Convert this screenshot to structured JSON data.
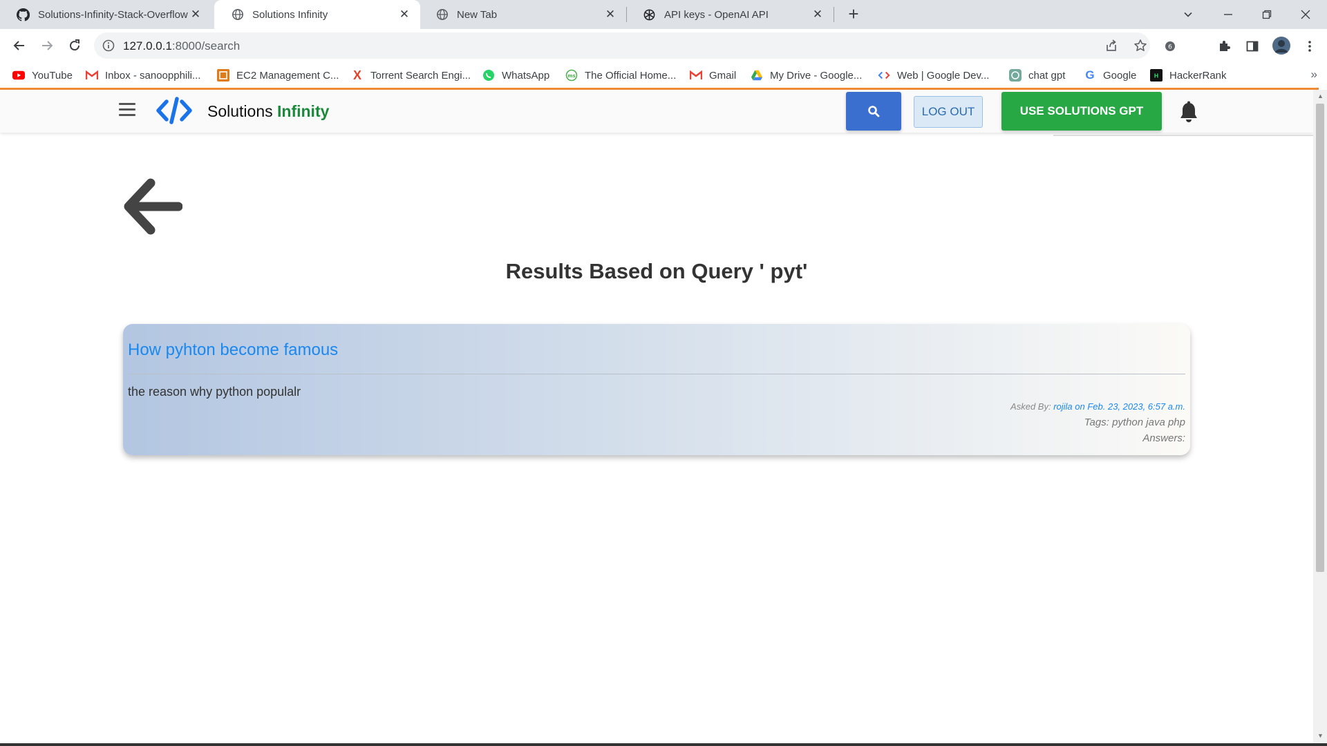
{
  "browser": {
    "tabs": [
      {
        "title": "Solutions-Infinity-Stack-Overflow",
        "icon": "github-icon",
        "active": false
      },
      {
        "title": "Solutions Infinity",
        "icon": "globe-icon",
        "active": true
      },
      {
        "title": "New Tab",
        "icon": "globe-icon",
        "active": false
      },
      {
        "title": "API keys - OpenAI API",
        "icon": "openai-icon",
        "active": false
      }
    ],
    "url_host": "127.0.0.1",
    "url_path": ":8000/search",
    "bookmarks": [
      {
        "label": "YouTube",
        "icon": "youtube-icon"
      },
      {
        "label": "Inbox - sanoopphili...",
        "icon": "gmail-icon"
      },
      {
        "label": "EC2 Management C...",
        "icon": "aws-icon"
      },
      {
        "label": "Torrent Search Engi...",
        "icon": "x-icon"
      },
      {
        "label": "WhatsApp",
        "icon": "whatsapp-icon"
      },
      {
        "label": "The Official Home...",
        "icon": "globe-icon"
      },
      {
        "label": "Gmail",
        "icon": "gmail-icon"
      },
      {
        "label": "My Drive - Google...",
        "icon": "drive-icon"
      },
      {
        "label": "Web  |  Google Dev...",
        "icon": "code-icon"
      },
      {
        "label": "chat gpt",
        "icon": "openai-icon"
      },
      {
        "label": "Google",
        "icon": "google-icon"
      },
      {
        "label": "HackerRank",
        "icon": "hackerrank-icon"
      }
    ],
    "more_label": "»"
  },
  "site": {
    "brand_prefix": "Solutions",
    "brand_accent": "Infinity",
    "logout_label": "LOG OUT",
    "gpt_label": "USE SOLUTIONS GPT",
    "colors": {
      "brand_green": "#1a8a3a",
      "primary_blue": "#3a6fd0",
      "gpt_green": "#28a745",
      "link_blue": "#1a88f0"
    }
  },
  "results": {
    "heading": "Results Based on Query ' pyt'",
    "items": [
      {
        "title": "How pyhton become famous",
        "body": "the reason why python populalr",
        "asked_by_label": "Asked By:",
        "asked_by_value": "rojila on Feb. 23, 2023, 6:57 a.m.",
        "tags": "Tags: python java php",
        "answers": "Answers:"
      }
    ]
  }
}
